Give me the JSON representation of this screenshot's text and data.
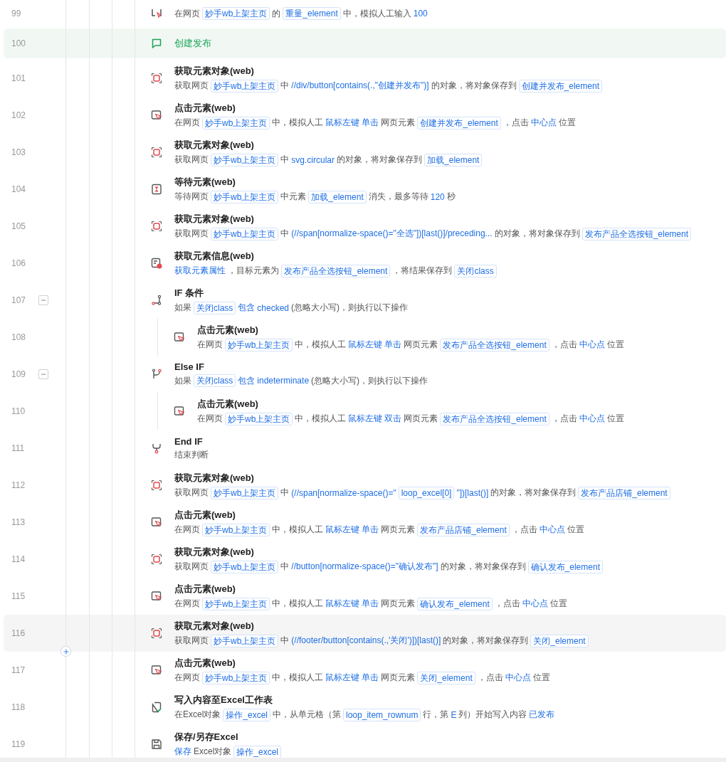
{
  "rows": [
    {
      "number": "99",
      "kind": "input",
      "selected": false,
      "description": [
        {
          "t": "在网页",
          "kind": "text"
        },
        {
          "t": "妙手wb上架主页",
          "kind": "tag"
        },
        {
          "t": "的",
          "kind": "text"
        },
        {
          "t": "重量_element",
          "kind": "tag"
        },
        {
          "t": "中，模拟人工输入",
          "kind": "text"
        },
        {
          "t": "100",
          "kind": "value"
        }
      ]
    },
    {
      "number": "100",
      "kind": "comment",
      "selected": false,
      "title": "创建发布"
    },
    {
      "number": "101",
      "kind": "get-element",
      "selected": false,
      "title": "获取元素对象(web)",
      "description": [
        {
          "t": "获取网页",
          "kind": "text"
        },
        {
          "t": "妙手wb上架主页",
          "kind": "tag"
        },
        {
          "t": "中",
          "kind": "text"
        },
        {
          "t": "//div/button[contains(.,\"创建并发布\")]",
          "kind": "value"
        },
        {
          "t": "的对象，将对象保存到",
          "kind": "text"
        },
        {
          "t": "创建并发布_element",
          "kind": "tag"
        }
      ]
    },
    {
      "number": "102",
      "kind": "click",
      "selected": false,
      "title": "点击元素(web)",
      "description": [
        {
          "t": "在网页",
          "kind": "text"
        },
        {
          "t": "妙手wb上架主页",
          "kind": "tag"
        },
        {
          "t": "中，模拟人工",
          "kind": "text"
        },
        {
          "t": "鼠标左键",
          "kind": "value"
        },
        {
          "t": "单击",
          "kind": "value"
        },
        {
          "t": "网页元素",
          "kind": "text"
        },
        {
          "t": "创建并发布_element",
          "kind": "tag"
        },
        {
          "t": "，点击",
          "kind": "text"
        },
        {
          "t": "中心点",
          "kind": "value"
        },
        {
          "t": "位置",
          "kind": "text"
        }
      ]
    },
    {
      "number": "103",
      "kind": "get-element",
      "selected": false,
      "title": "获取元素对象(web)",
      "description": [
        {
          "t": "获取网页",
          "kind": "text"
        },
        {
          "t": "妙手wb上架主页",
          "kind": "tag"
        },
        {
          "t": "中",
          "kind": "text"
        },
        {
          "t": "svg.circular",
          "kind": "value"
        },
        {
          "t": "的对象，将对象保存到",
          "kind": "text"
        },
        {
          "t": "加载_element",
          "kind": "tag"
        }
      ]
    },
    {
      "number": "104",
      "kind": "wait",
      "selected": false,
      "title": "等待元素(web)",
      "description": [
        {
          "t": "等待网页",
          "kind": "text"
        },
        {
          "t": "妙手wb上架主页",
          "kind": "tag"
        },
        {
          "t": "中元素",
          "kind": "text"
        },
        {
          "t": "加载_element",
          "kind": "tag"
        },
        {
          "t": "消失，最多等待",
          "kind": "text"
        },
        {
          "t": "120",
          "kind": "value"
        },
        {
          "t": "秒",
          "kind": "text"
        }
      ]
    },
    {
      "number": "105",
      "kind": "get-element",
      "selected": false,
      "title": "获取元素对象(web)",
      "description": [
        {
          "t": "获取网页",
          "kind": "text"
        },
        {
          "t": "妙手wb上架主页",
          "kind": "tag"
        },
        {
          "t": "中",
          "kind": "text"
        },
        {
          "t": "(//span[normalize-space()=\"全选\"])[last()]/preceding...",
          "kind": "value"
        },
        {
          "t": "的对象，将对象保存到",
          "kind": "text"
        },
        {
          "t": "发布产品全选按钮_element",
          "kind": "tag"
        }
      ]
    },
    {
      "number": "106",
      "kind": "info",
      "selected": false,
      "title": "获取元素信息(web)",
      "description": [
        {
          "t": "获取元素属性",
          "kind": "value"
        },
        {
          "t": "，目标元素为",
          "kind": "text"
        },
        {
          "t": "发布产品全选按钮_element",
          "kind": "tag"
        },
        {
          "t": "，将结果保存到",
          "kind": "text"
        },
        {
          "t": "关闭class",
          "kind": "tag"
        }
      ]
    },
    {
      "number": "107",
      "kind": "if",
      "selected": false,
      "expanded": true,
      "title": "IF 条件",
      "description": [
        {
          "t": "如果",
          "kind": "text"
        },
        {
          "t": "关闭class",
          "kind": "tag"
        },
        {
          "t": "包含",
          "kind": "value"
        },
        {
          "t": "checked",
          "kind": "value"
        },
        {
          "t": "(忽略大小写)，则执行以下操作",
          "kind": "text"
        }
      ],
      "children": [
        {
          "number": "108",
          "kind": "click",
          "selected": false,
          "title": "点击元素(web)",
          "description": [
            {
              "t": "在网页",
              "kind": "text"
            },
            {
              "t": "妙手wb上架主页",
              "kind": "tag"
            },
            {
              "t": "中，模拟人工",
              "kind": "text"
            },
            {
              "t": "鼠标左键",
              "kind": "value"
            },
            {
              "t": "单击",
              "kind": "value"
            },
            {
              "t": "网页元素",
              "kind": "text"
            },
            {
              "t": "发布产品全选按钮_element",
              "kind": "tag"
            },
            {
              "t": "，点击",
              "kind": "text"
            },
            {
              "t": "中心点",
              "kind": "value"
            },
            {
              "t": "位置",
              "kind": "text"
            }
          ]
        }
      ]
    },
    {
      "number": "109",
      "kind": "else-if",
      "selected": false,
      "expanded": true,
      "title": "Else IF",
      "description": [
        {
          "t": "如果",
          "kind": "text"
        },
        {
          "t": "关闭class",
          "kind": "tag"
        },
        {
          "t": "包含",
          "kind": "value"
        },
        {
          "t": "indeterminate",
          "kind": "value"
        },
        {
          "t": "(忽略大小写)，则执行以下操作",
          "kind": "text"
        }
      ],
      "children": [
        {
          "number": "110",
          "kind": "click",
          "selected": false,
          "title": "点击元素(web)",
          "description": [
            {
              "t": "在网页",
              "kind": "text"
            },
            {
              "t": "妙手wb上架主页",
              "kind": "tag"
            },
            {
              "t": "中，模拟人工",
              "kind": "text"
            },
            {
              "t": "鼠标左键",
              "kind": "value"
            },
            {
              "t": "双击",
              "kind": "value"
            },
            {
              "t": "网页元素",
              "kind": "text"
            },
            {
              "t": "发布产品全选按钮_element",
              "kind": "tag"
            },
            {
              "t": "，点击",
              "kind": "text"
            },
            {
              "t": "中心点",
              "kind": "value"
            },
            {
              "t": "位置",
              "kind": "text"
            }
          ]
        }
      ]
    },
    {
      "number": "111",
      "kind": "end-if",
      "selected": false,
      "title": "End IF",
      "description": [
        {
          "t": "结束判断",
          "kind": "text"
        }
      ]
    },
    {
      "number": "112",
      "kind": "get-element",
      "selected": false,
      "title": "获取元素对象(web)",
      "description": [
        {
          "t": "获取网页",
          "kind": "text"
        },
        {
          "t": "妙手wb上架主页",
          "kind": "tag"
        },
        {
          "t": "中",
          "kind": "text"
        },
        {
          "t": "(//span[normalize-space()=\"",
          "kind": "value"
        },
        {
          "t": "loop_excel[0]",
          "kind": "tag"
        },
        {
          "t": "\"])[last()]",
          "kind": "value"
        },
        {
          "t": "的对象，将对象保存到",
          "kind": "text"
        },
        {
          "t": "发布产品店铺_element",
          "kind": "tag"
        }
      ]
    },
    {
      "number": "113",
      "kind": "click",
      "selected": false,
      "title": "点击元素(web)",
      "description": [
        {
          "t": "在网页",
          "kind": "text"
        },
        {
          "t": "妙手wb上架主页",
          "kind": "tag"
        },
        {
          "t": "中，模拟人工",
          "kind": "text"
        },
        {
          "t": "鼠标左键",
          "kind": "value"
        },
        {
          "t": "单击",
          "kind": "value"
        },
        {
          "t": "网页元素",
          "kind": "text"
        },
        {
          "t": "发布产品店铺_element",
          "kind": "tag"
        },
        {
          "t": "，点击",
          "kind": "text"
        },
        {
          "t": "中心点",
          "kind": "value"
        },
        {
          "t": "位置",
          "kind": "text"
        }
      ]
    },
    {
      "number": "114",
      "kind": "get-element",
      "selected": false,
      "title": "获取元素对象(web)",
      "description": [
        {
          "t": "获取网页",
          "kind": "text"
        },
        {
          "t": "妙手wb上架主页",
          "kind": "tag"
        },
        {
          "t": "中",
          "kind": "text"
        },
        {
          "t": "//button[normalize-space()=\"确认发布\"]",
          "kind": "value"
        },
        {
          "t": "的对象，将对象保存到",
          "kind": "text"
        },
        {
          "t": "确认发布_element",
          "kind": "tag"
        }
      ]
    },
    {
      "number": "115",
      "kind": "click",
      "selected": false,
      "title": "点击元素(web)",
      "description": [
        {
          "t": "在网页",
          "kind": "text"
        },
        {
          "t": "妙手wb上架主页",
          "kind": "tag"
        },
        {
          "t": "中，模拟人工",
          "kind": "text"
        },
        {
          "t": "鼠标左键",
          "kind": "value"
        },
        {
          "t": "单击",
          "kind": "value"
        },
        {
          "t": "网页元素",
          "kind": "text"
        },
        {
          "t": "确认发布_element",
          "kind": "tag"
        },
        {
          "t": "，点击",
          "kind": "text"
        },
        {
          "t": "中心点",
          "kind": "value"
        },
        {
          "t": "位置",
          "kind": "text"
        }
      ]
    },
    {
      "number": "116",
      "kind": "get-element",
      "selected": true,
      "title": "获取元素对象(web)",
      "description": [
        {
          "t": "获取网页",
          "kind": "text"
        },
        {
          "t": "妙手wb上架主页",
          "kind": "tag"
        },
        {
          "t": "中",
          "kind": "text"
        },
        {
          "t": "(//footer/button[contains(.,'关闭')])[last()]",
          "kind": "value"
        },
        {
          "t": "的对象，将对象保存到",
          "kind": "text"
        },
        {
          "t": "关闭_element",
          "kind": "tag"
        }
      ]
    },
    {
      "number": "117",
      "kind": "click",
      "selected": false,
      "title": "点击元素(web)",
      "description": [
        {
          "t": "在网页",
          "kind": "text"
        },
        {
          "t": "妙手wb上架主页",
          "kind": "tag"
        },
        {
          "t": "中，模拟人工",
          "kind": "text"
        },
        {
          "t": "鼠标左键",
          "kind": "value"
        },
        {
          "t": "单击",
          "kind": "value"
        },
        {
          "t": "网页元素",
          "kind": "text"
        },
        {
          "t": "关闭_element",
          "kind": "tag"
        },
        {
          "t": "，点击",
          "kind": "text"
        },
        {
          "t": "中心点",
          "kind": "value"
        },
        {
          "t": "位置",
          "kind": "text"
        }
      ]
    },
    {
      "number": "118",
      "kind": "excel-write",
      "selected": false,
      "title": "写入内容至Excel工作表",
      "description": [
        {
          "t": "在Excel对象",
          "kind": "text"
        },
        {
          "t": "操作_excel",
          "kind": "tag"
        },
        {
          "t": "中，从单元格（第",
          "kind": "text"
        },
        {
          "t": "loop_item_rownum",
          "kind": "tag"
        },
        {
          "t": "行，第",
          "kind": "text"
        },
        {
          "t": "E",
          "kind": "value"
        },
        {
          "t": "列）开始写入内容",
          "kind": "text"
        },
        {
          "t": "已发布",
          "kind": "value"
        }
      ]
    },
    {
      "number": "119",
      "kind": "save",
      "selected": false,
      "title": "保存/另存Excel",
      "description": [
        {
          "t": "保存",
          "kind": "value"
        },
        {
          "t": "Excel对象",
          "kind": "text"
        },
        {
          "t": "操作_excel",
          "kind": "tag"
        }
      ]
    }
  ]
}
